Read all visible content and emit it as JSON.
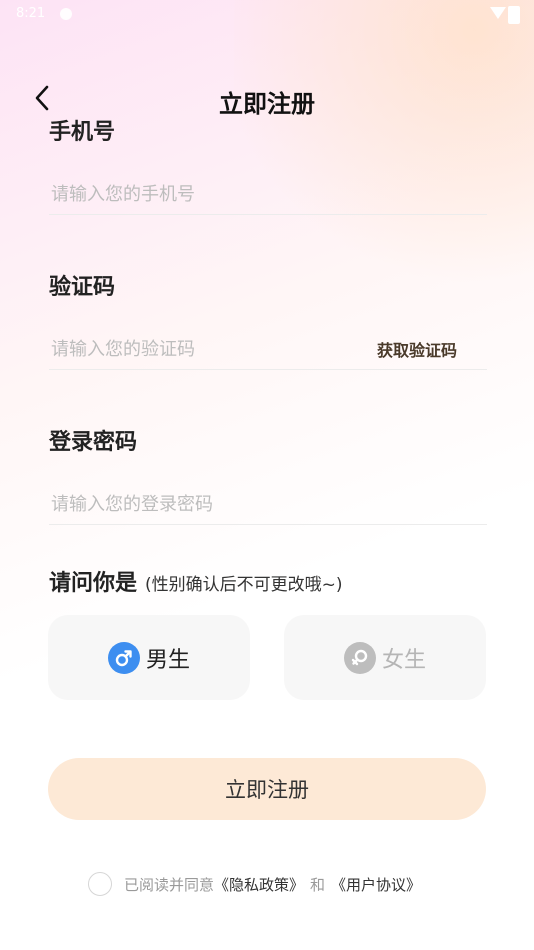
{
  "status": {
    "time": "8:21"
  },
  "header": {
    "title": "立即注册"
  },
  "phone": {
    "label": "手机号",
    "placeholder": "请输入您的手机号"
  },
  "code": {
    "label": "验证码",
    "placeholder": "请输入您的验证码",
    "get_code": "获取验证码"
  },
  "password": {
    "label": "登录密码",
    "placeholder": "请输入您的登录密码"
  },
  "gender": {
    "label": "请问你是",
    "note": "(性别确认后不可更改哦~)",
    "male": "男生",
    "female": "女生",
    "male_color": "#3d8ef0",
    "female_color": "#bdbdbd"
  },
  "submit": {
    "label": "立即注册"
  },
  "agreement": {
    "prefix": "已阅读并同意",
    "privacy": "《隐私政策》",
    "and": "和",
    "terms": "《用户协议》"
  }
}
